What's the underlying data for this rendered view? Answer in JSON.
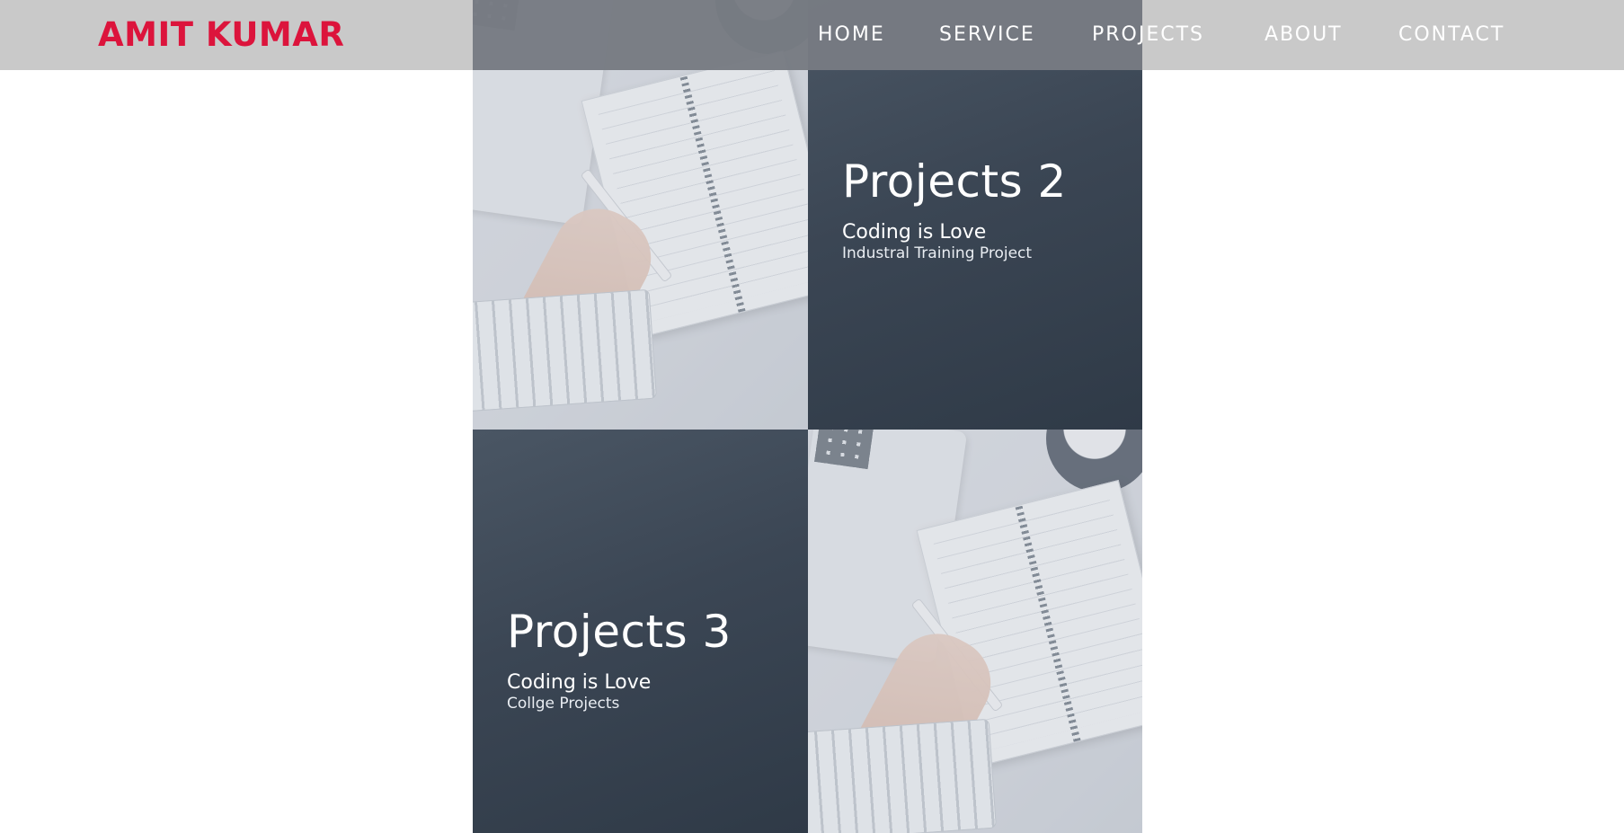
{
  "brand": {
    "name": "AMIT KUMAR",
    "color": "#dc143c"
  },
  "nav": {
    "items": [
      {
        "label": "HOME"
      },
      {
        "label": "SERVICE"
      },
      {
        "label": "PROJECTS"
      },
      {
        "label": "ABOUT"
      },
      {
        "label": "CONTACT"
      }
    ]
  },
  "projects": [
    {
      "title": "Projects 2",
      "tagline": "Coding is Love",
      "description": "Industral Training Project"
    },
    {
      "title": "Projects 3",
      "tagline": "Coding is Love",
      "description": "Collge Projects"
    }
  ],
  "images": {
    "project_photo": "desk-notebook-photo"
  },
  "colors": {
    "navbar_bg": "#c4c4c4",
    "info_panel": "#3b4654",
    "text": "#ffffff"
  }
}
